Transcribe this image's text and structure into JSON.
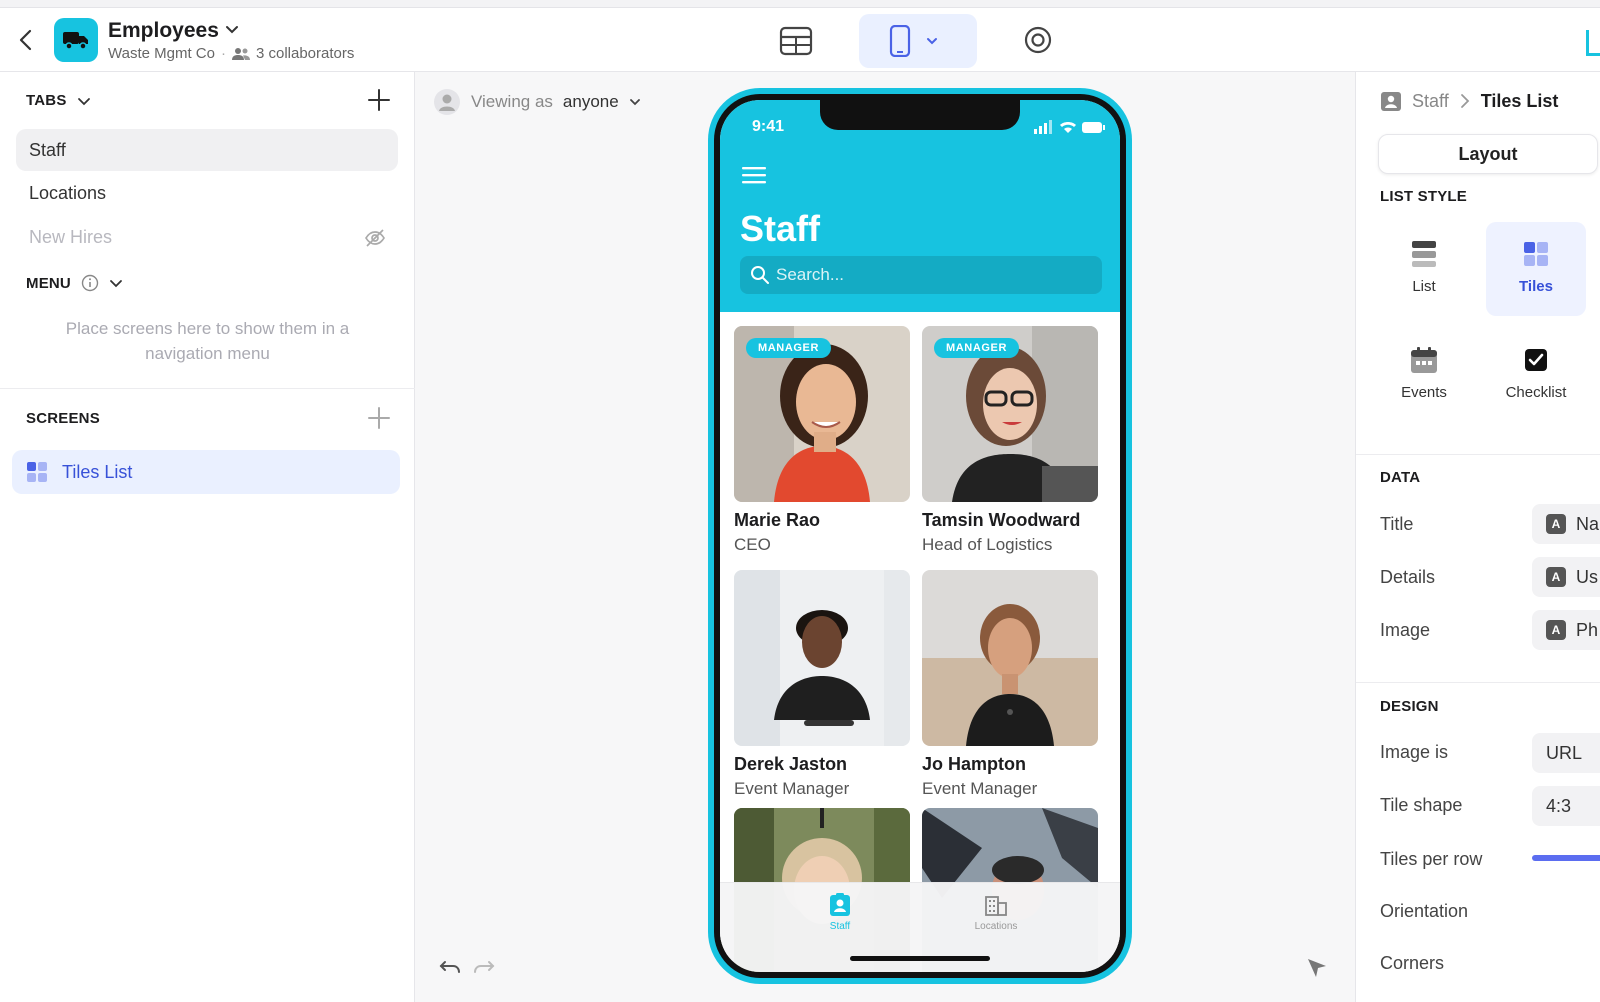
{
  "app": {
    "name": "Employees",
    "org": "Waste Mgmt Co",
    "collaborators": "3 collaborators"
  },
  "left": {
    "tabs_heading": "TABS",
    "tabs": [
      {
        "label": "Staff"
      },
      {
        "label": "Locations"
      },
      {
        "label": "New Hires"
      }
    ],
    "menu_heading": "MENU",
    "menu_hint": "Place screens here to show them in a navigation menu",
    "screens_heading": "SCREENS",
    "screens": [
      {
        "label": "Tiles List"
      }
    ]
  },
  "canvas": {
    "viewing_prefix": "Viewing as",
    "viewing_as": "anyone"
  },
  "phone": {
    "time": "9:41",
    "title": "Staff",
    "search_placeholder": "Search...",
    "tiles": [
      {
        "name": "Marie Rao",
        "role": "CEO",
        "badge": "MANAGER"
      },
      {
        "name": "Tamsin Woodward",
        "role": "Head of Logistics",
        "badge": "MANAGER"
      },
      {
        "name": "Derek Jaston",
        "role": "Event Manager",
        "badge": ""
      },
      {
        "name": "Jo Hampton",
        "role": "Event Manager",
        "badge": ""
      }
    ],
    "tabbar": [
      {
        "label": "Staff",
        "active": true
      },
      {
        "label": "Locations",
        "active": false
      }
    ]
  },
  "right": {
    "crumb_parent": "Staff",
    "crumb_current": "Tiles List",
    "tab": "Layout",
    "list_style_heading": "LIST STYLE",
    "list_styles": [
      {
        "label": "List",
        "active": false
      },
      {
        "label": "Tiles",
        "active": true
      },
      {
        "label": "Events",
        "active": false
      },
      {
        "label": "Checklist",
        "active": false
      }
    ],
    "data_heading": "DATA",
    "data_fields": [
      {
        "label": "Title",
        "value": "Na"
      },
      {
        "label": "Details",
        "value": "Us"
      },
      {
        "label": "Image",
        "value": "Ph"
      }
    ],
    "design_heading": "DESIGN",
    "design_fields": [
      {
        "label": "Image is",
        "value": "URL"
      },
      {
        "label": "Tile shape",
        "value": "4:3"
      },
      {
        "label": "Tiles per row",
        "value": ""
      },
      {
        "label": "Orientation",
        "value": ""
      },
      {
        "label": "Corners",
        "value": ""
      }
    ]
  },
  "colors": {
    "accent": "#17c3e0",
    "selection": "#3751d8"
  }
}
